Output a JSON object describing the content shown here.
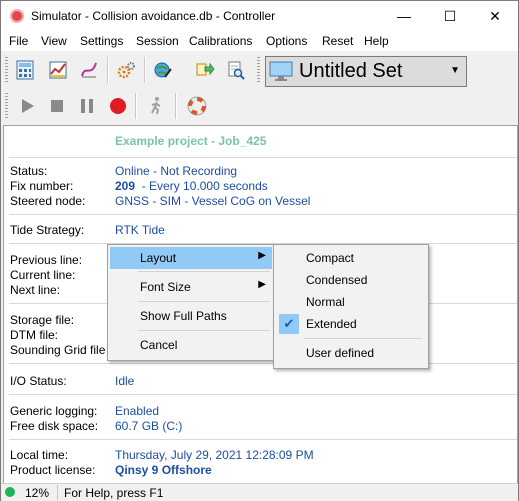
{
  "window": {
    "title": "Simulator - Collision avoidance.db - Controller",
    "minimize": "—",
    "maximize": "☐",
    "close": "✕"
  },
  "menubar": [
    "File",
    "View",
    "Settings",
    "Session",
    "Calibrations",
    "Options",
    "Reset",
    "Help"
  ],
  "toolbar": {
    "top_icons": [
      "calculator-icon",
      "chart-icon",
      "curve-icon",
      "settings-gears-icon",
      "globe-edit-icon",
      "transfer-icon",
      "document-search-icon"
    ],
    "set_combo": "Untitled Set",
    "bottom_icons": [
      "play-icon",
      "stop-icon",
      "pause-icon",
      "record-icon",
      "walking-icon",
      "lifebuoy-icon"
    ]
  },
  "panel": {
    "project": "Example project - Job_425",
    "status_label": "Status:",
    "status_value": "Online - Not Recording",
    "fix_label": "Fix number:",
    "fix_number": "209",
    "fix_rate": "- Every 10.000 seconds",
    "steered_label": "Steered node:",
    "steered_value": "GNSS - SIM - Vessel CoG on Vessel",
    "tide_label": "Tide Strategy:",
    "tide_value": "RTK Tide",
    "previous_line_label": "Previous line:",
    "current_line_label": "Current line:",
    "next_line_label": "Next line:",
    "storage_label": "Storage file:",
    "dtm_label": "DTM file:",
    "grid_label": "Sounding Grid file",
    "io_label": "I/O Status:",
    "io_value": "Idle",
    "logging_label": "Generic logging:",
    "logging_value": "Enabled",
    "disk_label": "Free disk space:",
    "disk_value": "60.7 GB (C:)",
    "time_label": "Local time:",
    "time_value": "Thursday, July 29, 2021 12:28:09 PM",
    "license_label": "Product license:",
    "license_value": "Qinsy 9 Offshore"
  },
  "context_menu": {
    "items": [
      "Layout",
      "Font Size",
      "Show Full Paths",
      "Cancel"
    ],
    "submenu": [
      "Compact",
      "Condensed",
      "Normal",
      "Extended",
      "User defined"
    ],
    "checked_item": "Extended"
  },
  "statusbar": {
    "percent": "12%",
    "help": "For Help, press F1"
  },
  "colors": {
    "value_blue": "#1f4ea0",
    "project_green": "#7cc4a2",
    "highlight": "#91c9f7",
    "status_green": "#1fb45a"
  }
}
